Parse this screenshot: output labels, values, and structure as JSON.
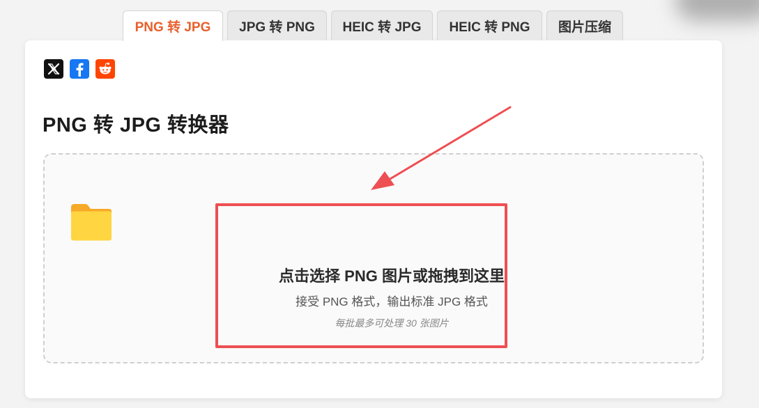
{
  "tabs": [
    {
      "label": "PNG 转 JPG",
      "active": true
    },
    {
      "label": "JPG 转 PNG",
      "active": false
    },
    {
      "label": "HEIC 转 JPG",
      "active": false
    },
    {
      "label": "HEIC 转 PNG",
      "active": false
    },
    {
      "label": "图片压缩",
      "active": false
    }
  ],
  "share": {
    "items": [
      {
        "icon": "x-twitter-icon",
        "color": "#111111"
      },
      {
        "icon": "facebook-icon",
        "color": "#1877f2"
      },
      {
        "icon": "reddit-icon",
        "color": "#ff4500"
      }
    ]
  },
  "page_title": "PNG 转 JPG 转换器",
  "dropzone": {
    "icon": "folder-icon",
    "main_text": "点击选择 PNG 图片或拖拽到这里",
    "sub_text": "接受 PNG 格式，输出标准 JPG 格式",
    "limit_text": "每批最多可处理 30 张图片"
  },
  "annotation": {
    "color": "#ee4f52"
  },
  "colors": {
    "accent": "#e8602c",
    "folder": "#ffc93c"
  }
}
